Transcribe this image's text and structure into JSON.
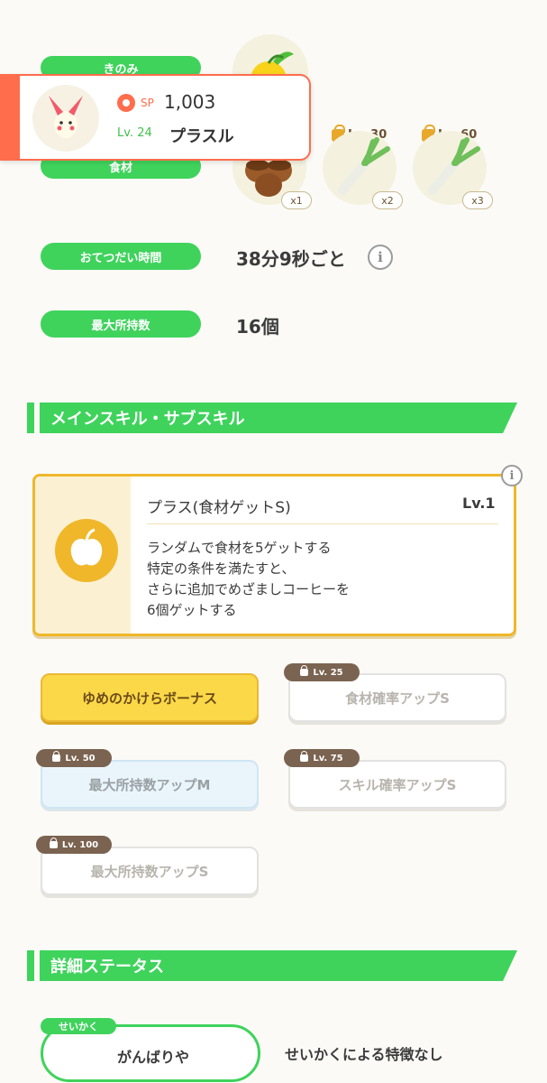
{
  "berries_label": "きのみ",
  "ingredients_label": "食材",
  "pokemon_card": {
    "sp_label": "SP",
    "sp_value": "1,003",
    "level": "Lv. 24",
    "name": "プラスル"
  },
  "ingredient_slots": [
    {
      "lock_level": "",
      "qty": "x1",
      "icon": "acorn-icon"
    },
    {
      "lock_level": "Lv. 30",
      "qty": "x2",
      "icon": "leek-icon"
    },
    {
      "lock_level": "Lv. 60",
      "qty": "x3",
      "icon": "leek-icon"
    }
  ],
  "help_time": {
    "label": "おてつだい時間",
    "value": "38分9秒ごと"
  },
  "max_carry": {
    "label": "最大所持数",
    "value": "16個"
  },
  "skills_section_title": "メインスキル・サブスキル",
  "main_skill": {
    "name": "プラス(食材ゲットS)",
    "level": "Lv.1",
    "desc_lines": [
      "ランダムで食材を5ゲットする",
      "特定の条件を満たすと、",
      "さらに追加でめざましコーヒーを",
      "6個ゲットする"
    ],
    "icon": "apple-icon"
  },
  "sub_skills": [
    {
      "label": "ゆめのかけらボーナス",
      "lock_level": ""
    },
    {
      "label": "食材確率アップS",
      "lock_level": "Lv. 25"
    },
    {
      "label": "最大所持数アップM",
      "lock_level": "Lv. 50"
    },
    {
      "label": "スキル確率アップS",
      "lock_level": "Lv. 75"
    },
    {
      "label": "最大所持数アップS",
      "lock_level": "Lv. 100"
    }
  ],
  "details_section_title": "詳細ステータス",
  "nature": {
    "tag": "せいかく",
    "value": "がんばりや",
    "effect": "せいかくによる特徴なし"
  },
  "colors": {
    "accent_green": "#3fd35c",
    "gold": "#f0b72b",
    "card_red": "#ff6d4d"
  }
}
